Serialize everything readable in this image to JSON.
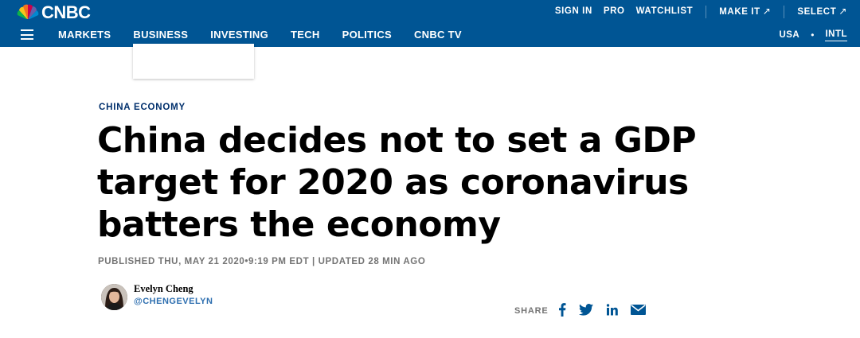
{
  "brand": {
    "name": "CNBC",
    "color": "#005594"
  },
  "utility_nav": {
    "sign_in": "SIGN IN",
    "pro": "PRO",
    "watchlist": "WATCHLIST",
    "make_it": "MAKE IT",
    "select": "SELECT",
    "external_arrow": "↗"
  },
  "main_nav": {
    "menu_icon": "hamburger-menu-icon",
    "items": [
      {
        "label": "MARKETS"
      },
      {
        "label": "BUSINESS"
      },
      {
        "label": "INVESTING"
      },
      {
        "label": "TECH"
      },
      {
        "label": "POLITICS"
      },
      {
        "label": "CNBC TV"
      }
    ]
  },
  "edition": {
    "usa": "USA",
    "separator": "•",
    "intl": "INTL",
    "active": "INTL"
  },
  "article": {
    "kicker": "CHINA ECONOMY",
    "headline": "China decides not to set a GDP target for 2020 as coronavirus batters the economy",
    "timestamp": "PUBLISHED THU, MAY 21 2020•9:19 PM EDT | UPDATED 28 MIN AGO",
    "author": {
      "name": "Evelyn Cheng",
      "handle": "@CHENGEVELYN"
    }
  },
  "share": {
    "label": "SHARE",
    "icons": [
      "facebook-icon",
      "twitter-icon",
      "linkedin-icon",
      "email-icon"
    ],
    "icon_color": "#005594"
  }
}
